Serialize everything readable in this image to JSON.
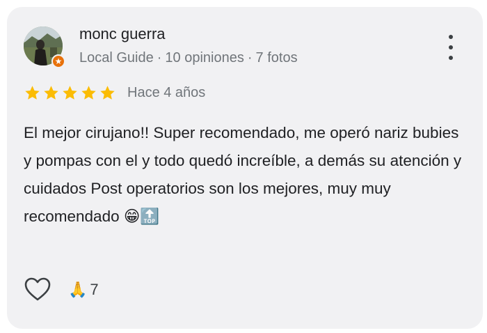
{
  "reviewer": {
    "name": "monc guerra",
    "level": "Local Guide",
    "reviews": "10 opiniones",
    "photos": "7 fotos",
    "separator": "·"
  },
  "review": {
    "rating": 5,
    "max_rating": 5,
    "date": "Hace 4 años",
    "text": "El mejor cirujano!! Super recomendado, me operó nariz bubies y pompas con el y todo quedó increíble, a demás su atención y cuidados Post operatorios son los mejores, muy muy recomendado 😁🔝"
  },
  "reactions": {
    "emoji": "🙏",
    "count": "7"
  },
  "icons": {
    "more": "more-vert-icon",
    "like": "heart-outline-icon",
    "star": "star-icon",
    "badge": "local-guide-star-icon"
  },
  "colors": {
    "card_bg": "#f1f1f3",
    "star": "#fbbc04",
    "text_primary": "#202124",
    "text_secondary": "#70757a",
    "badge": "#e8710a"
  }
}
